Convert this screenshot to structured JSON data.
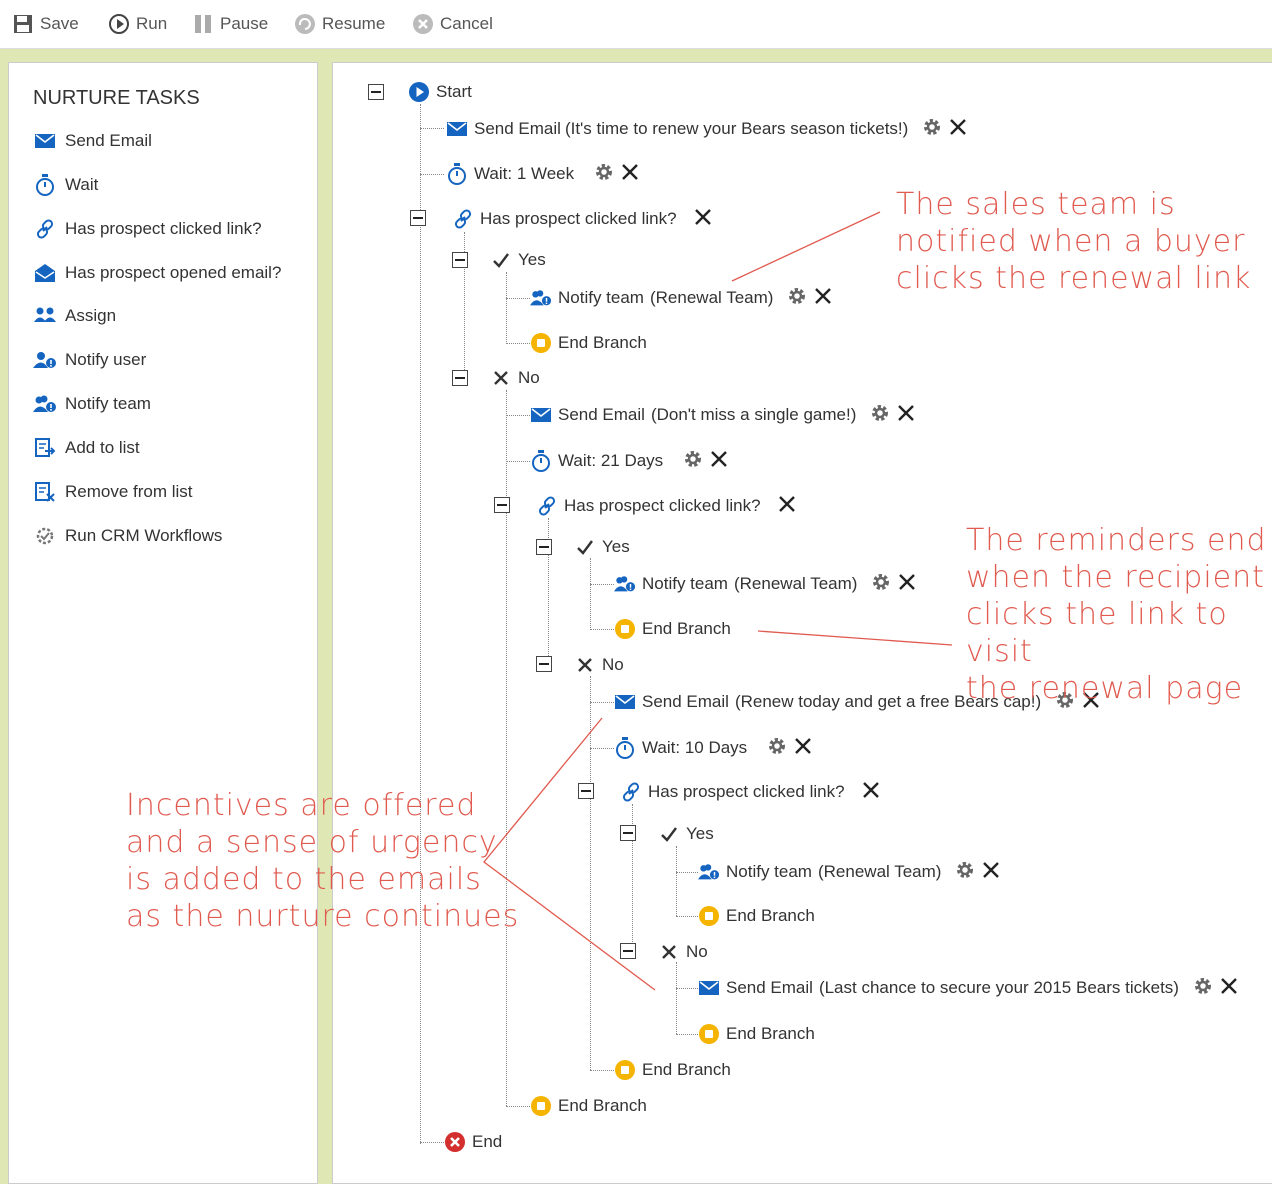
{
  "toolbar": {
    "save": "Save",
    "run": "Run",
    "pause": "Pause",
    "resume": "Resume",
    "cancel": "Cancel"
  },
  "sidebar": {
    "title": "NURTURE TASKS",
    "items": [
      {
        "label": "Send Email",
        "icon": "envelope-icon"
      },
      {
        "label": "Wait",
        "icon": "stopwatch-icon"
      },
      {
        "label": "Has prospect clicked link?",
        "icon": "link-icon"
      },
      {
        "label": "Has prospect opened email?",
        "icon": "open-envelope-icon"
      },
      {
        "label": "Assign",
        "icon": "assign-icon"
      },
      {
        "label": "Notify user",
        "icon": "notify-user-icon"
      },
      {
        "label": "Notify team",
        "icon": "notify-team-icon"
      },
      {
        "label": "Add to list",
        "icon": "add-list-icon"
      },
      {
        "label": "Remove from list",
        "icon": "remove-list-icon"
      },
      {
        "label": "Run CRM Workflows",
        "icon": "workflow-icon"
      }
    ]
  },
  "tree": {
    "start": "Start",
    "end": "End",
    "yes": "Yes",
    "no": "No",
    "end_branch": "End Branch",
    "send_email": "Send Email",
    "notify_team": "Notify team",
    "has_clicked": "Has prospect clicked link?",
    "email1": "(It's time to renew your Bears season tickets!)",
    "wait1": "Wait: 1 Week",
    "email2": "(Don't miss a single game!)",
    "wait2": "Wait: 21 Days",
    "email3": "(Renew today and get a free Bears cap!)",
    "wait3": "Wait: 10 Days",
    "email4": "(Last chance to secure your 2015 Bears tickets)",
    "team": "(Renewal Team)"
  },
  "annotations": {
    "note1": "The sales team is\nnotified when a buyer\nclicks the renewal link",
    "note2": "The reminders end\nwhen the recipient\nclicks the link to visit\nthe renewal page",
    "note3": "Incentives are offered\nand a sense of urgency\nis added to the emails\nas the nurture continues"
  },
  "colors": {
    "accent_blue": "#1565c0",
    "end_branch_yellow": "#f5b400",
    "end_red": "#d32f2f",
    "annotation_red": "#e05a4f",
    "page_bg": "#dfe8b4"
  }
}
